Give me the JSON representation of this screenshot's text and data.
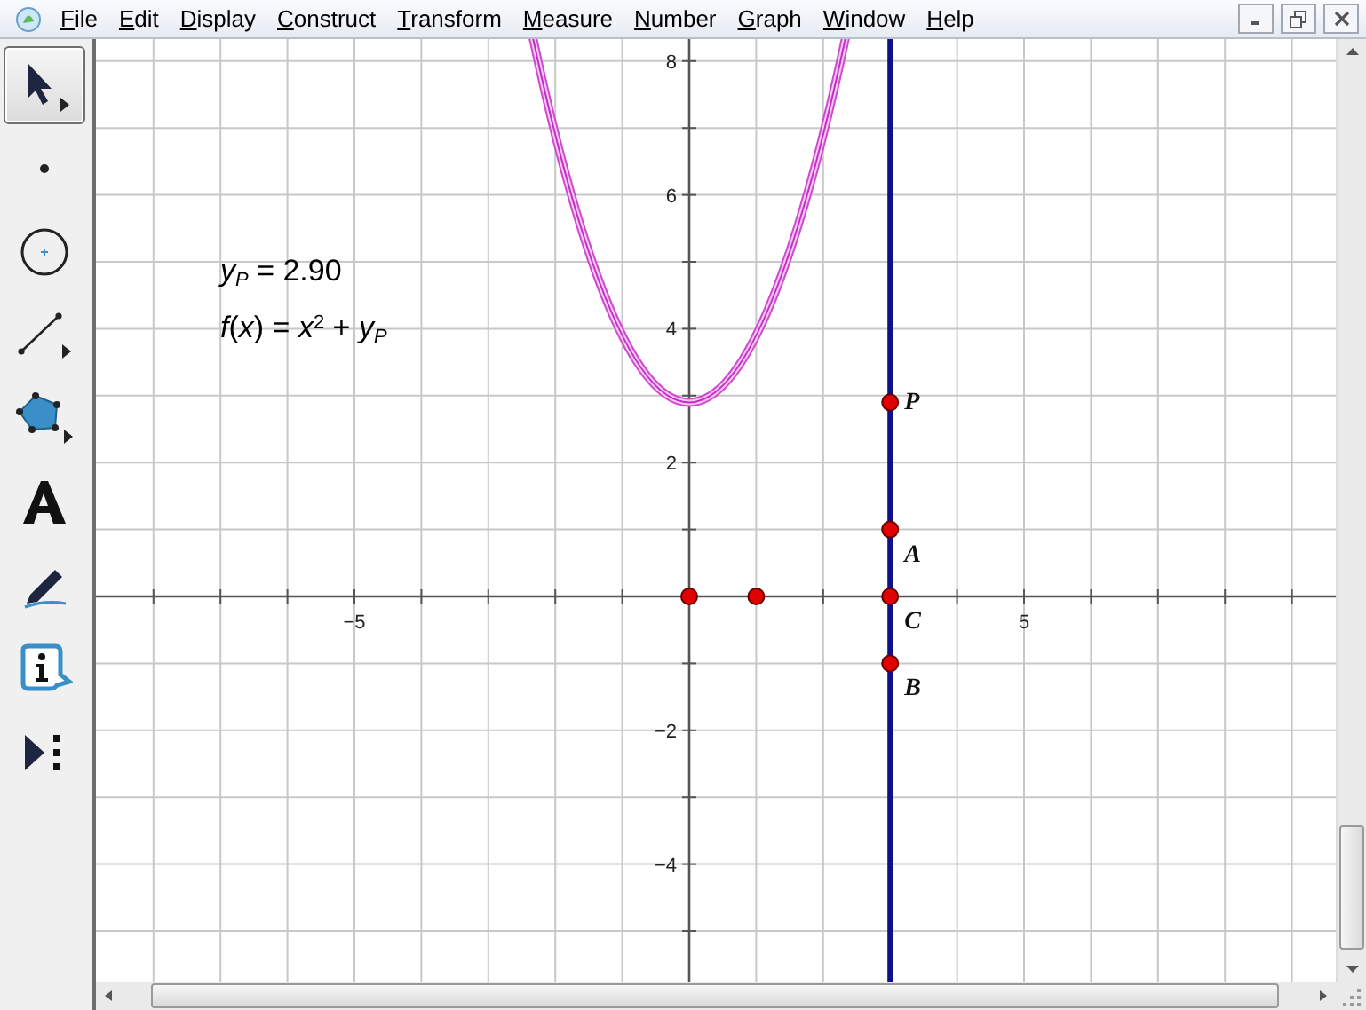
{
  "menu_bar": {
    "items": [
      {
        "label": "File"
      },
      {
        "label": "Edit"
      },
      {
        "label": "Display"
      },
      {
        "label": "Construct"
      },
      {
        "label": "Transform"
      },
      {
        "label": "Measure"
      },
      {
        "label": "Number"
      },
      {
        "label": "Graph"
      },
      {
        "label": "Window"
      },
      {
        "label": "Help"
      }
    ]
  },
  "toolbox": [
    {
      "kind": "arrow",
      "selected": true
    },
    {
      "kind": "point",
      "selected": false
    },
    {
      "kind": "compass",
      "selected": false
    },
    {
      "kind": "straightedge",
      "selected": false
    },
    {
      "kind": "polygon",
      "selected": false
    },
    {
      "kind": "text",
      "selected": false
    },
    {
      "kind": "marker",
      "selected": false
    },
    {
      "kind": "information",
      "selected": false
    },
    {
      "kind": "custom",
      "selected": false
    }
  ],
  "canvas": {
    "measurements": [
      "*y*$_{P}$ = 2.90",
      "*f*(*x*) = *x*$^{2}$ + *y*$_{P}$"
    ],
    "x_tick_labels": [
      "−5",
      "5"
    ],
    "y_tick_labels": [
      "8",
      "6",
      "4",
      "2",
      "−2",
      "−4"
    ],
    "points": [
      {
        "label": "P"
      },
      {
        "label": "A"
      },
      {
        "label": "C"
      },
      {
        "label": "B"
      }
    ]
  }
}
